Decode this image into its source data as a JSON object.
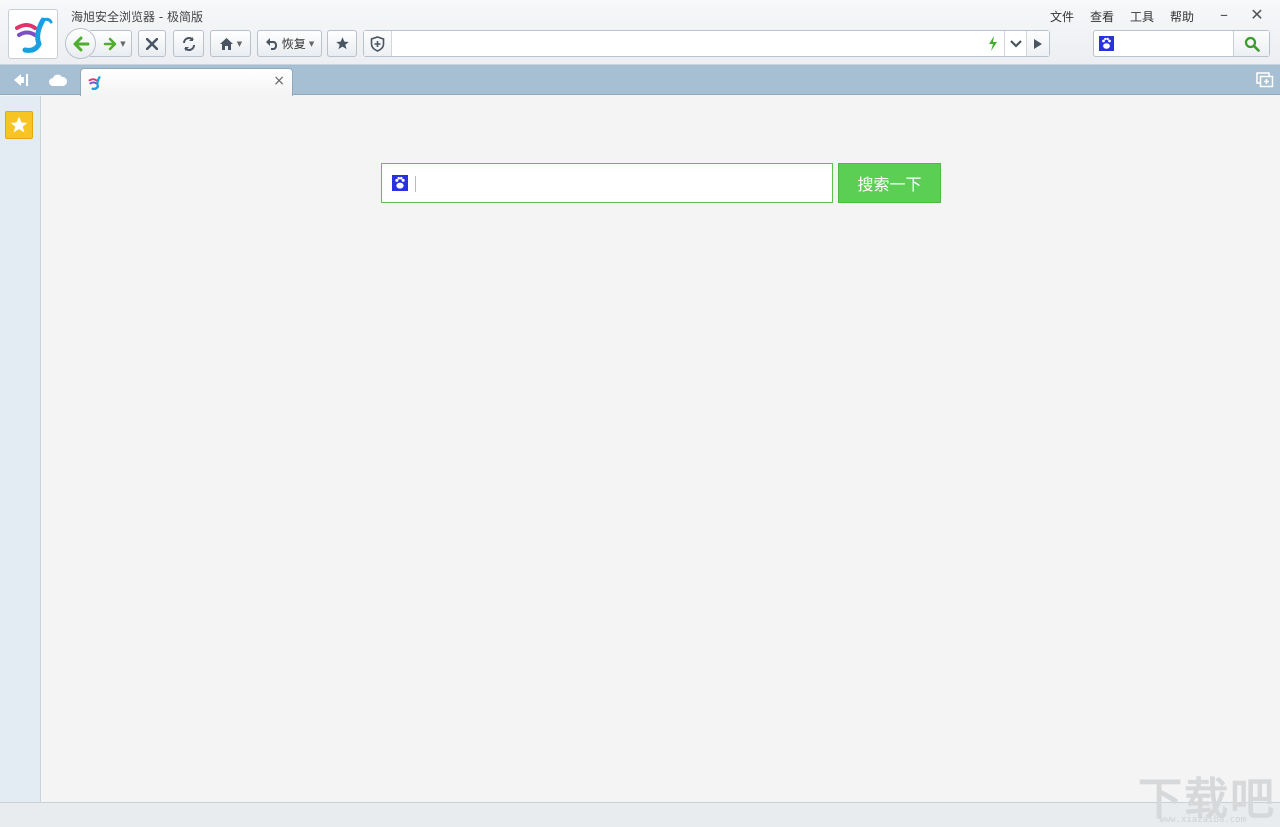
{
  "window": {
    "title": "海旭安全浏览器 - 极简版",
    "menus": [
      "文件",
      "查看",
      "工具",
      "帮助"
    ],
    "minimize_glyph": "–",
    "close_glyph": "✕"
  },
  "toolbar": {
    "restore_label": "恢复",
    "address_value": "",
    "address_placeholder": "",
    "search_value": "",
    "search_placeholder": ""
  },
  "tabs": [
    {
      "title": "",
      "close_glyph": "×"
    }
  ],
  "main": {
    "search_value": "",
    "search_placeholder": "",
    "search_button_label": "搜索一下"
  },
  "watermark": {
    "text": "下载吧",
    "url": "www.xiazaiba.com"
  },
  "colors": {
    "accent_green": "#5bcf53",
    "tabstrip": "#a6bfd3",
    "sidebar": "#e3ebf3",
    "favorites_yellow": "#f6c423"
  },
  "icons": [
    "app-logo-icon",
    "back-arrow-icon",
    "forward-arrow-icon",
    "stop-icon",
    "refresh-icon",
    "home-icon",
    "undo-icon",
    "star-icon",
    "shield-icon",
    "bolt-icon",
    "chevron-down-icon",
    "go-arrow-icon",
    "baidu-paw-icon",
    "search-icon",
    "sidebar-toggle-icon",
    "cloud-icon",
    "new-tab-icon"
  ]
}
